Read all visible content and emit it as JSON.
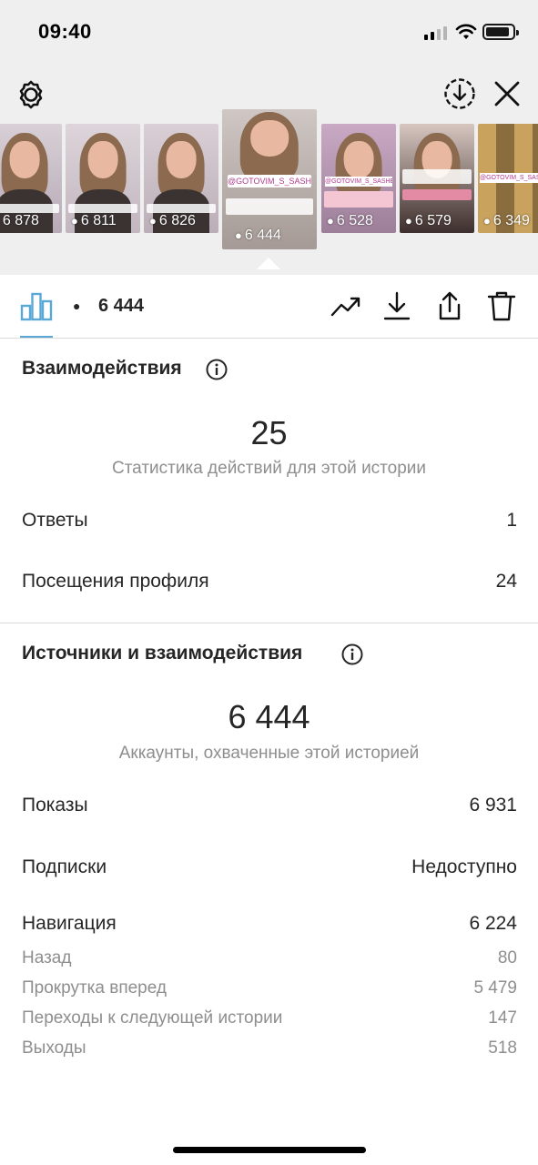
{
  "status_bar": {
    "time": "09:40"
  },
  "header": {
    "settings_icon": "gear-icon",
    "download_icon": "download-circle-icon",
    "close_icon": "close-icon"
  },
  "stories": [
    {
      "views": "6 878",
      "selected": false
    },
    {
      "views": "6 811",
      "selected": false
    },
    {
      "views": "6 826",
      "selected": false
    },
    {
      "views": "6 444",
      "selected": true,
      "caption": "@GOTOVIM_S_SASHEY"
    },
    {
      "views": "6 528",
      "selected": false,
      "caption": "@GOTOVIM_S_SASHEY"
    },
    {
      "views": "6 579",
      "selected": false
    },
    {
      "views": "6 349",
      "selected": false,
      "caption": "@GOTOVIM_S_SASHEY"
    }
  ],
  "toolbar": {
    "views": "6 444",
    "icons": [
      "bar-chart-icon",
      "eye-icon",
      "trending-icon",
      "download-icon",
      "share-icon",
      "trash-icon"
    ],
    "accent": "#5aa8d8"
  },
  "interactions": {
    "title": "Взаимодействия",
    "total": "25",
    "subtitle": "Статистика действий для этой истории",
    "rows": [
      {
        "label": "Ответы",
        "value": "1"
      },
      {
        "label": "Посещения профиля",
        "value": "24"
      }
    ]
  },
  "discovery": {
    "title": "Источники и взаимодействия",
    "total": "6 444",
    "subtitle": "Аккаунты, охваченные этой историей",
    "rows": [
      {
        "label": "Показы",
        "value": "6 931"
      },
      {
        "label": "Подписки",
        "value": "Недоступно"
      },
      {
        "label": "Навигация",
        "value": "6 224"
      }
    ],
    "nav_rows": [
      {
        "label": "Назад",
        "value": "80"
      },
      {
        "label": "Прокрутка вперед",
        "value": "5 479"
      },
      {
        "label": "Переходы к следующей истории",
        "value": "147"
      },
      {
        "label": "Выходы",
        "value": "518"
      }
    ]
  }
}
